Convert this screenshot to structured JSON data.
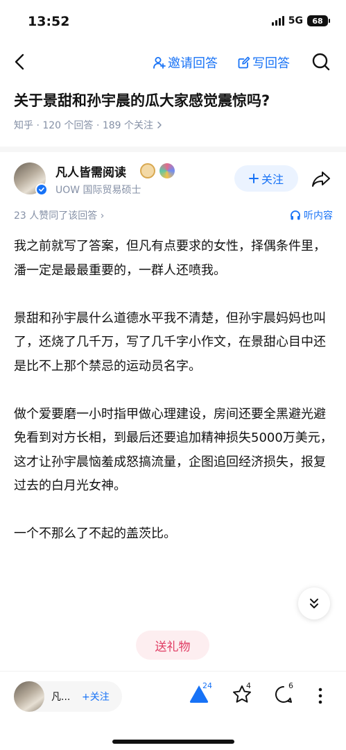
{
  "status_bar": {
    "time": "13:52",
    "network": "5G",
    "battery": "68"
  },
  "nav": {
    "invite_label": "邀请回答",
    "write_label": "写回答"
  },
  "question": {
    "title": "关于景甜和孙宇晨的瓜大家感觉震惊吗?",
    "meta": "知乎 · 120 个回答 · 189 个关注"
  },
  "author": {
    "name": "凡人皆需阅读",
    "description": "UOW 国际贸易硕士",
    "follow_label": "关注"
  },
  "answer": {
    "votes_text": "23 人赞同了该回答",
    "listen_label": "听内容",
    "paragraphs": [
      "我之前就写了答案，但凡有点要求的女性，择偶条件里，潘一定是最最重要的，一群人还喷我。",
      "景甜和孙宇晨什么道德水平我不清楚，但孙宇晨妈妈也叫了，还烧了几千万，写了几千字小作文，在景甜心目中还是比不上那个禁忌的运动员名字。",
      "做个爱要磨一小时指甲做心理建设，房间还要全黑避光避免看到对方长相，到最后还要追加精神损失5000万美元，这才让孙宇晨恼羞成怒搞流量，企图追回经济损失，报复过去的白月光女神。",
      "一个不那么了不起的盖茨比。"
    ]
  },
  "gift_label": "送礼物",
  "bottom_bar": {
    "author_short": "凡...",
    "follow_label": "+关注",
    "upvote_count": "24",
    "favorite_count": "4",
    "comment_count": "6"
  },
  "colors": {
    "accent": "#1772f6",
    "gift": "#e03c63",
    "meta": "#8590a6"
  }
}
